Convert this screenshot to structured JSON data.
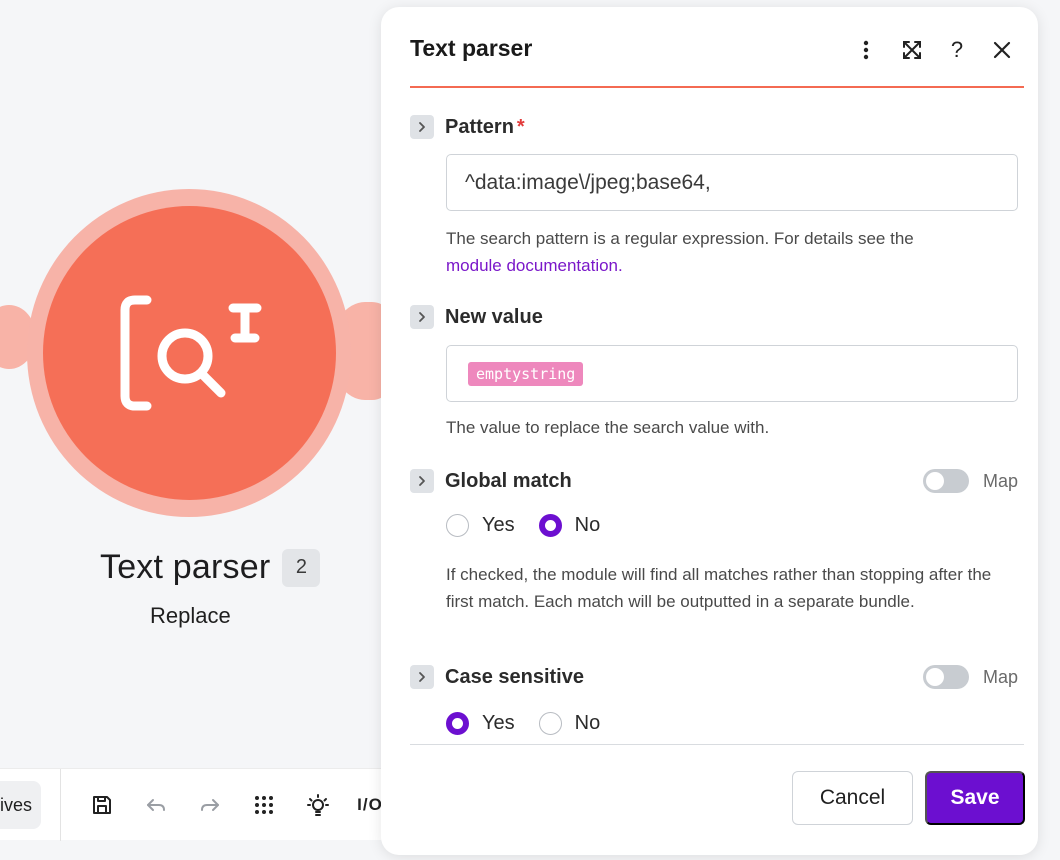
{
  "module": {
    "title": "Text parser",
    "badge": "2",
    "subtitle": "Replace",
    "icon": "text-search-icon",
    "color": "#f56f57"
  },
  "toolbar": {
    "chip_label": "ives",
    "items": [
      "save-icon",
      "undo-icon",
      "redo-icon",
      "grid-dots-icon",
      "lightbulb-icon",
      "io-icon"
    ],
    "io_label": "I/O"
  },
  "panel": {
    "title": "Text parser",
    "header_icons": [
      "more-vertical-icon",
      "expand-icon",
      "help-icon",
      "close-icon"
    ],
    "help_glyph": "?",
    "accent": "#f46a52",
    "fields": {
      "pattern": {
        "label": "Pattern",
        "required_mark": "*",
        "value": "^data:image\\/jpeg;base64,",
        "help_text": "The search pattern is a regular expression. For details see the",
        "help_link": "module documentation."
      },
      "new_value": {
        "label": "New value",
        "value_pill": "emptystring",
        "help_text": "The value to replace the search value with."
      },
      "global_match": {
        "label": "Global match",
        "map_label": "Map",
        "options": [
          "Yes",
          "No"
        ],
        "selected": "No",
        "help_text": "If checked, the module will find all matches rather than stopping after the first match. Each match will be outputted in a separate bundle."
      },
      "case_sensitive": {
        "label": "Case sensitive",
        "map_label": "Map",
        "options": [
          "Yes",
          "No"
        ],
        "selected": "Yes"
      }
    },
    "footer": {
      "cancel_label": "Cancel",
      "save_label": "Save",
      "save_color": "#6c0fd0"
    }
  }
}
